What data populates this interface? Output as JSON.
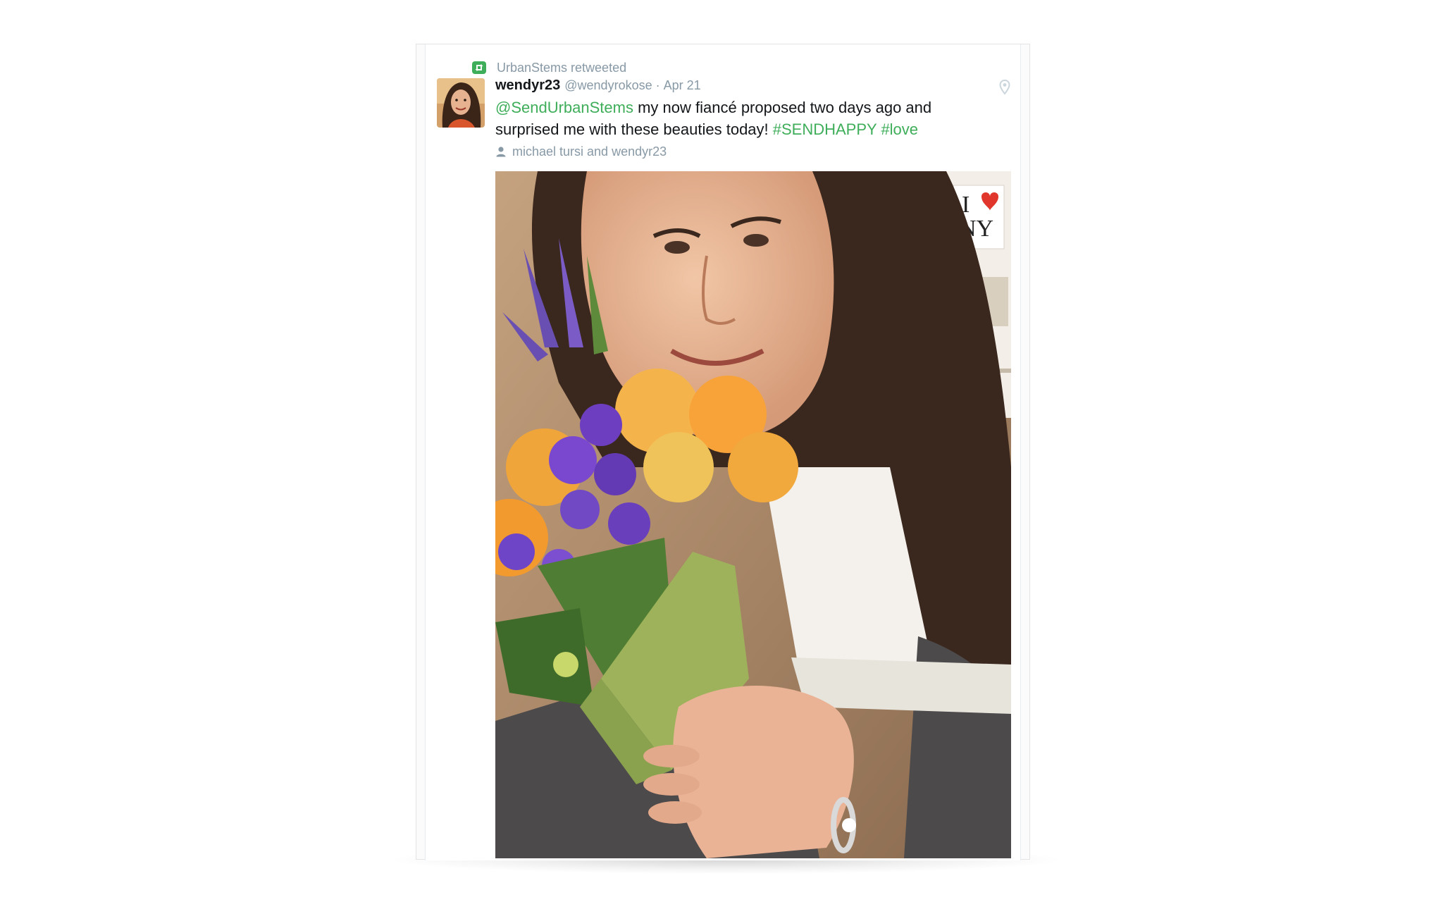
{
  "retweet": {
    "text": "UrbanStems retweeted",
    "icon": "retweet-icon"
  },
  "tweet": {
    "author_name": "wendyr23",
    "author_handle": "@wendyrokose",
    "separator": "·",
    "date": "Apr 21",
    "text": {
      "mention": "@SendUrbanStems",
      "body": " my now fiancé proposed two days ago and surprised me with these beauties today! ",
      "hashtag1": "#SENDHAPPY",
      "space": " ",
      "hashtag2": "#love"
    },
    "tagged": "michael tursi and wendyr23",
    "location_icon": "map-pin-icon",
    "user_icon": "user-icon",
    "photo_poster_text": {
      "line1": "I",
      "line2": "NY"
    }
  },
  "colors": {
    "accent": "#3fae5a",
    "muted": "#8899a6",
    "text": "#14171a"
  }
}
